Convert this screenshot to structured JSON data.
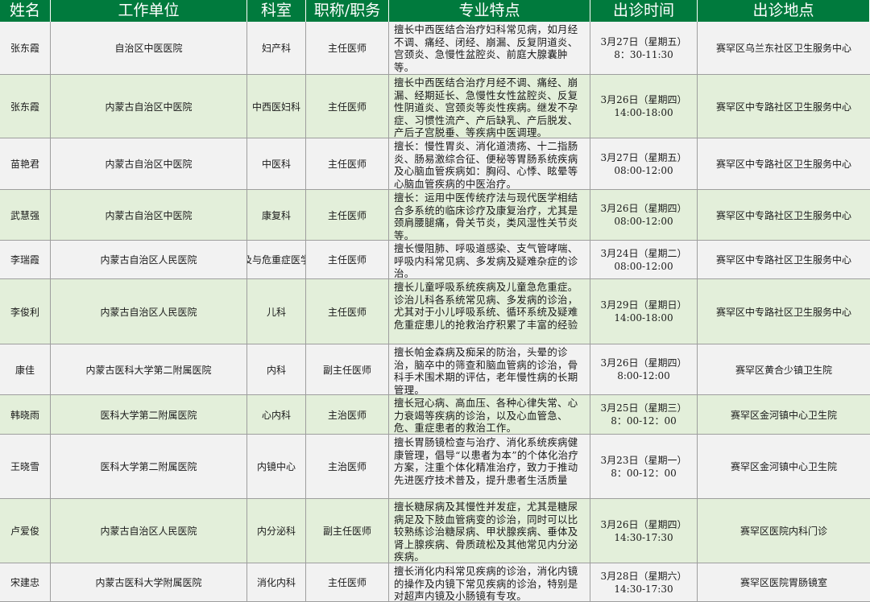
{
  "headers": [
    "姓名",
    "工作单位",
    "科室",
    "职称/职务",
    "专业特点",
    "出诊时间",
    "出诊地点"
  ],
  "rows": [
    {
      "name": "张东霞",
      "org": "自治区中医医院",
      "dept": "妇产科",
      "title": "主任医师",
      "spec": "擅长中西医结合治疗妇科常见病，如月经不调、痛经、闭经、崩漏、反复阴道炎、宫颈炎、急慢性盆腔炎、前庭大腺囊肿等。",
      "date": "3月27日（星期五）",
      "time": "8：30-11:30",
      "place": "赛罕区乌兰东社区卫生服务中心"
    },
    {
      "name": "张东霞",
      "org": "内蒙古自治区中医院",
      "dept": "中西医妇科",
      "title": "主任医师",
      "spec": "擅长中西医结合治疗月经不调、痛经、崩漏、经期延长、急慢性女性盆腔炎、反复性阴道炎、宫颈炎等炎性疾病。继发不孕症、习惯性流产、产后缺乳、产后脱发、产后子宫脱垂、等疾病中医调理。",
      "date": "3月26日（星期四）",
      "time": "14:00-18:00",
      "place": "赛罕区中专路社区卫生服务中心"
    },
    {
      "name": "苗艳君",
      "org": "内蒙古自治区中医院",
      "dept": "中医科",
      "title": "主任医师",
      "spec": "擅长：慢性胃炎、消化道溃疡、十二指肠炎、肠易激综合征、便秘等胃肠系统疾病及心脑血管疾病如：胸闷、心悸、眩晕等心脑血管疾病的中医治疗。",
      "date": "3月27日（星期五）",
      "time": "08:00-12:00",
      "place": "赛罕区中专路社区卫生服务中心"
    },
    {
      "name": "武慧强",
      "org": "内蒙古自治区中医院",
      "dept": "康复科",
      "title": "主任医师",
      "spec": "擅长：运用中医传统疗法与现代医学相结合多系统的临床诊疗及康复治疗，尤其是颈肩腰腿痛，骨关节炎，类风湿性关节炎等。",
      "date": "3月26日（星期四）",
      "time": "08:00-12:00",
      "place": "赛罕区中专路社区卫生服务中心"
    },
    {
      "name": "李瑞霞",
      "org": "内蒙古自治区人民医院",
      "dept": "及与危重症医学",
      "title": "主任医师",
      "spec": "擅长慢阻肺、呼吸道感染、支气管哮喘、呼吸内科常见病、多发病及疑难杂症的诊治。",
      "date": "3月24日（星期二）",
      "time": "08:00-12:00",
      "place": "赛罕区中专路社区卫生服务中心"
    },
    {
      "name": "李俊利",
      "org": "内蒙古自治区人民医院",
      "dept": "儿科",
      "title": "主任医师",
      "spec": "擅长儿童呼吸系统疾病及儿童急危重症。诊治儿科各系统常见病、多发病的诊治，尤其对于小儿呼吸系统、循环系统及疑难危重症患儿的抢救治疗积累了丰富的经验",
      "date": "3月29日（星期日）",
      "time": "14:00-18:00",
      "place": "赛罕区中专路社区卫生服务中心"
    },
    {
      "name": "康佳",
      "org": "内蒙古医科大学第二附属医院",
      "dept": "内科",
      "title": "副主任医师",
      "spec": "擅长帕金森病及痴呆的防治，头晕的诊治，脑卒中的筛查和脑血管病的诊治，骨科手术围术期的评估，老年慢性病的长期管理。",
      "date": "3月26日（星期四）",
      "time": "8:00-12:00",
      "place": "赛罕区黄合少镇卫生院"
    },
    {
      "name": "韩晓雨",
      "org": "医科大学第二附属医院",
      "dept": "心内科",
      "title": "主治医师",
      "spec": "擅长冠心病、高血压、各种心律失常、心力衰竭等疾病的诊治，以及心血管急、危、重症患者的救治工作。",
      "date": "3月25日（星期三）",
      "time": "8：00-12：00",
      "place": "赛罕区金河镇中心卫生院"
    },
    {
      "name": "王晓雪",
      "org": "医科大学第二附属医院",
      "dept": "内镜中心",
      "title": "主治医师",
      "spec": "擅长胃肠镜检查与治疗、消化系统疾病健康管理，倡导“以患者为本”的个体化治疗方案，注重个体化精准治疗，致力于推动先进医疗技术普及，提升患者生活质量",
      "date": "3月23日（星期一）",
      "time": "8：00-12：00",
      "place": "赛罕区金河镇中心卫生院"
    },
    {
      "name": "卢爱俊",
      "org": "内蒙古自治区人民医院",
      "dept": "内分泌科",
      "title": "副主任医师",
      "spec": "擅长糖尿病及其慢性并发症，尤其是糖尿病足及下肢血管病变的诊治，同时可以比较熟练诊治糖尿病、甲状腺疾病、垂体及肾上腺疾病、骨质疏松及其他常见内分泌疾病。",
      "date": "3月26日（星期四）",
      "time": "14:30-17:30",
      "place": "赛罕区医院内科门诊"
    },
    {
      "name": "宋建忠",
      "org": "内蒙古医科大学附属医院",
      "dept": "消化内科",
      "title": "主任医师",
      "spec": "擅长消化内科常见疾病的诊治，消化内镜的操作及内镜下常见疾病的诊治，特别是对超声内镜及小肠镜有专攻。",
      "date": "3月28日（星期六）",
      "time": "14:30-17:30",
      "place": "赛罕区医院胃肠镜室"
    }
  ]
}
